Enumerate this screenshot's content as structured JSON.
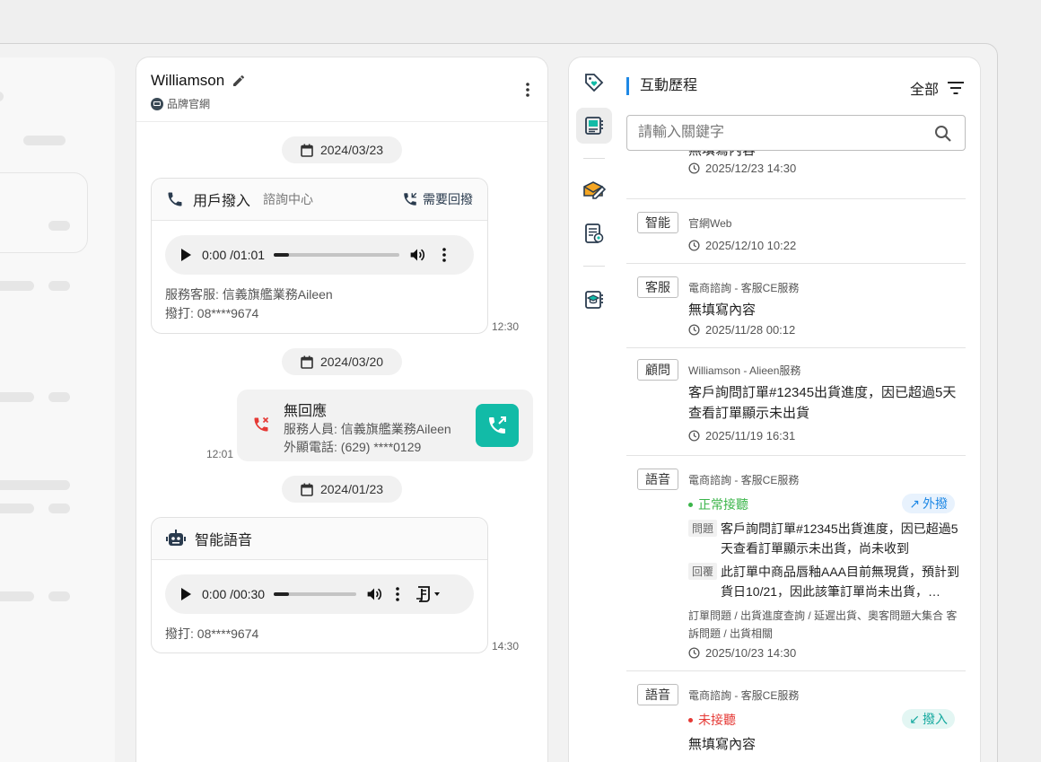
{
  "chat": {
    "name": "Williamson",
    "source": "品牌官網",
    "blocks": {
      "d1": "2024/03/23",
      "call1": {
        "title": "用戶撥入",
        "sub": "諮詢中心",
        "callback": "需要回撥",
        "time": "0:00 /01:01",
        "progress": 0.12,
        "agent": "服務客服: 信義旗艦業務Aileen",
        "dial": "撥打: 08****9674",
        "ts": "12:30"
      },
      "d2": "2024/03/20",
      "missed": {
        "title": "無回應",
        "agent": "服務人員: 信義旗艦業務Aileen",
        "phone": "外顯電話: (629) ****0129",
        "ts": "12:01"
      },
      "d3": "2024/01/23",
      "voice": {
        "title": "智能語音",
        "time": "0:00 /00:30",
        "progress": 0.18,
        "dial": "撥打: 08****9674",
        "ts": "14:30"
      }
    }
  },
  "history": {
    "title": "互動歷程",
    "filter": "全部",
    "search_placeholder": "請輸入關鍵字",
    "items": [
      {
        "main": "無填寫內容",
        "time": "2025/12/23 14:30"
      },
      {
        "tag": "智能",
        "src": "官網Web",
        "time": "2025/12/10 10:22"
      },
      {
        "tag": "客服",
        "src": "電商諮詢 - 客服CE服務",
        "main": "無填寫內容",
        "time": "2025/11/28 00:12"
      },
      {
        "tag": "顧問",
        "src": "Williamson - Alieen服務",
        "main": "客戶詢問訂單#12345出貨進度，因已超過5天查看訂單顯示未出貨",
        "time": "2025/11/19 16:31"
      },
      {
        "tag": "語音",
        "src": "電商諮詢 - 客服CE服務",
        "status": "正常接聽",
        "status_color": "#3bb54a",
        "dir": "外撥",
        "dir_color": "#1e88e5",
        "dir_bg": "#e8f2fd",
        "q_label": "問題",
        "q": "客戶詢問訂單#12345出貨進度，因已超過5天查看訂單顯示未出貨，尚未收到",
        "a_label": "回覆",
        "a": "此訂單中商品唇釉AAA目前無現貨，預計到貨日10/21，因此該筆訂單尚未出貨，…",
        "cats": "訂單問題 / 出貨進度查詢 / 延遲出貨、奧客問題大集合 客訴問題 / 出貨相關",
        "time": "2025/10/23 14:30"
      },
      {
        "tag": "語音",
        "src": "電商諮詢 - 客服CE服務",
        "status": "未接聽",
        "status_color": "#e53935",
        "dir": "撥入",
        "dir_color": "#13a89e",
        "dir_bg": "#e3f6f3",
        "main": "無填寫內容"
      }
    ]
  },
  "colors": {
    "accent": "#1e88e5",
    "teal": "#12bba7",
    "missed": "#e53935"
  }
}
